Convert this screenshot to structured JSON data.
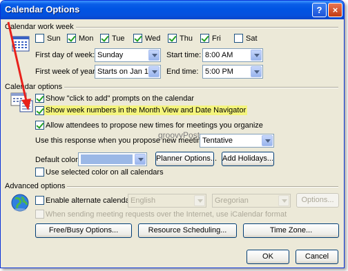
{
  "window": {
    "title": "Calendar Options",
    "help": "?",
    "close": "×"
  },
  "work_week": {
    "section_label": "Calendar work week",
    "days": [
      {
        "label": "Sun",
        "checked": false
      },
      {
        "label": "Mon",
        "checked": true
      },
      {
        "label": "Tue",
        "checked": true
      },
      {
        "label": "Wed",
        "checked": true
      },
      {
        "label": "Thu",
        "checked": true
      },
      {
        "label": "Fri",
        "checked": true
      },
      {
        "label": "Sat",
        "checked": false
      }
    ],
    "first_day_label": "First day of week:",
    "first_day_value": "Sunday",
    "start_time_label": "Start time:",
    "start_time_value": "8:00 AM",
    "first_week_label": "First week of year:",
    "first_week_value": "Starts on Jan 1",
    "end_time_label": "End time:",
    "end_time_value": "5:00 PM"
  },
  "calendar_options": {
    "section_label": "Calendar options",
    "click_to_add": "Show \"click to add\" prompts on the calendar",
    "week_numbers": "Show week numbers in the Month View and Date Navigator",
    "allow_propose": "Allow attendees to propose new times for meetings you organize",
    "response_label": "Use this response when you propose new meeting times:",
    "response_value": "Tentative",
    "default_color_label": "Default color:",
    "planner_button": "Planner Options...",
    "holidays_button": "Add Holidays...",
    "selected_color": "Use selected color on all calendars",
    "swatch_color": "#9bb8e6"
  },
  "advanced": {
    "section_label": "Advanced options",
    "alt_calendar": "Enable alternate calendar:",
    "alt_language_value": "English",
    "alt_type_value": "Gregorian",
    "options_button": "Options...",
    "icalendar": "When sending meeting requests over the Internet, use iCalendar format",
    "freebusy_button": "Free/Busy Options...",
    "resource_button": "Resource Scheduling...",
    "timezone_button": "Time Zone..."
  },
  "footer": {
    "ok": "OK",
    "cancel": "Cancel"
  },
  "watermark": "groovyPost",
  "colors": {
    "title_bar": "#0054e3",
    "dialog_bg": "#ece9d8",
    "highlight": "#f4f47c",
    "annotation_arrow": "#e8211b"
  }
}
